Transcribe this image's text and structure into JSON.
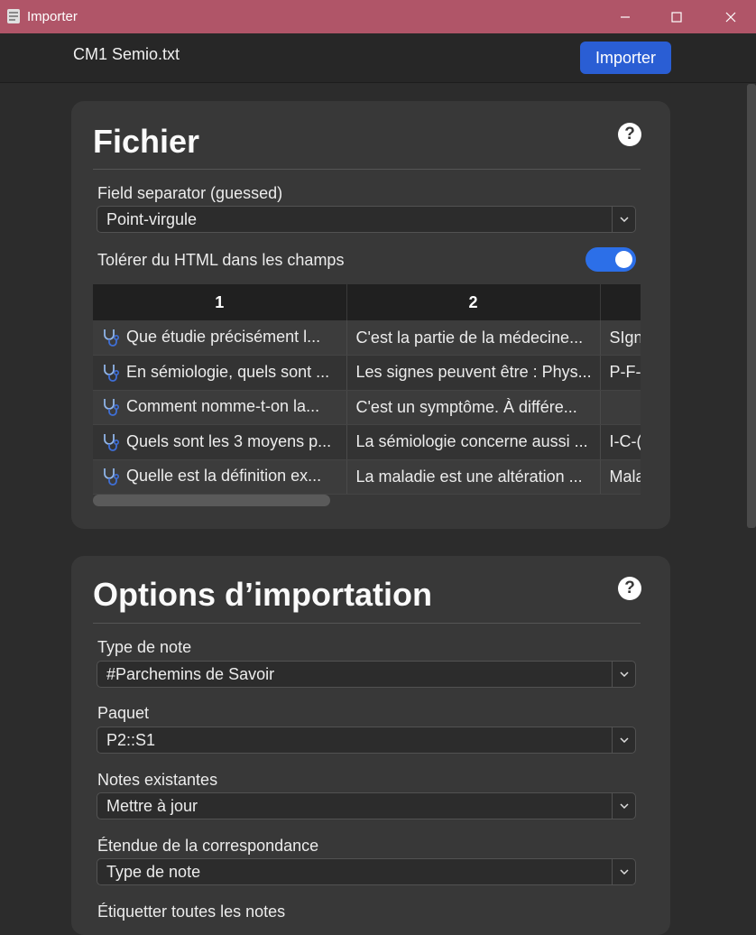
{
  "window": {
    "title": "Importer",
    "minimize_icon": "minimize-icon",
    "maximize_icon": "maximize-icon",
    "close_icon": "close-icon"
  },
  "header": {
    "filename": "CM1 Semio.txt",
    "import_label": "Importer"
  },
  "file_section": {
    "title": "Fichier",
    "help_icon": "help-icon",
    "separator_label": "Field separator (guessed)",
    "separator_value": "Point-virgule",
    "html_label": "Tolérer du HTML dans les champs",
    "html_enabled": true,
    "table": {
      "headers": [
        "1",
        "2",
        ""
      ],
      "rows": [
        [
          "Que étudie précisément l...",
          "C'est la partie de la médecine...",
          "SIgn"
        ],
        [
          "En sémiologie, quels sont ...",
          "Les signes peuvent être : Phys...",
          "P-F-"
        ],
        [
          "Comment nomme-t-on la...",
          "C'est un symptôme. À différe...",
          ""
        ],
        [
          "Quels sont les 3 moyens p...",
          "La sémiologie concerne aussi ...",
          "I-C-("
        ],
        [
          "Quelle est la définition ex...",
          "La maladie est une altération ...",
          "Mala"
        ]
      ],
      "row_icon": "stethoscope-icon"
    }
  },
  "options_section": {
    "title": "Options d’importation",
    "help_icon": "help-icon",
    "note_type_label": "Type de note",
    "note_type_value": "#Parchemins de Savoir",
    "deck_label": "Paquet",
    "deck_value": "P2::S1",
    "existing_label": "Notes existantes",
    "existing_value": "Mettre à jour",
    "match_scope_label": "Étendue de la correspondance",
    "match_scope_value": "Type de note",
    "tag_all_label": "Étiquetter toutes les notes"
  },
  "colors": {
    "titlebar": "#b05568",
    "accent": "#2a5ed4",
    "toggle": "#2c6fe8",
    "card": "#383838"
  }
}
